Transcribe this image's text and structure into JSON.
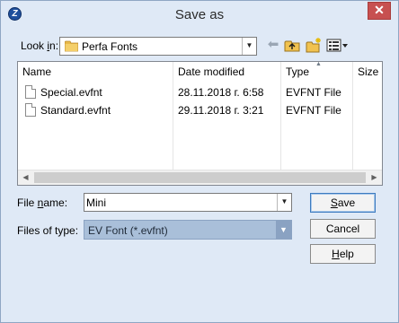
{
  "window": {
    "title": "Save as",
    "app_icon_glyph": "Z",
    "close_glyph": "✕"
  },
  "look_in": {
    "label_prefix": "Look ",
    "label_mnemonic": "i",
    "label_suffix": "n:",
    "value": "Perfa Fonts",
    "icon": "folder-icon"
  },
  "toolbar": {
    "back_icon": "back-arrow-icon",
    "up_icon": "up-folder-icon",
    "new_folder_icon": "new-folder-icon",
    "view_menu_icon": "view-menu-icon"
  },
  "file_list": {
    "columns": [
      "Name",
      "Date modified",
      "Type",
      "Size"
    ],
    "sort_column": "Type",
    "files": [
      {
        "name": "Special.evfnt",
        "date": "28.11.2018 г. 6:58",
        "type": "EVFNT File",
        "size": ""
      },
      {
        "name": "Standard.evfnt",
        "date": "29.11.2018 г. 3:21",
        "type": "EVFNT File",
        "size": ""
      }
    ]
  },
  "file_name": {
    "label_prefix": "File ",
    "label_mnemonic": "n",
    "label_suffix": "ame:",
    "value": "Mini"
  },
  "file_type": {
    "label": "Files of type:",
    "value": "EV Font (*.evfnt)"
  },
  "buttons": {
    "save_mnemonic": "S",
    "save_rest": "ave",
    "cancel": "Cancel",
    "help_mnemonic": "H",
    "help_rest": "elp"
  },
  "colors": {
    "window_bg": "#dfe9f6",
    "close_button": "#c75050",
    "selected_combo": "#a9bfd9"
  }
}
